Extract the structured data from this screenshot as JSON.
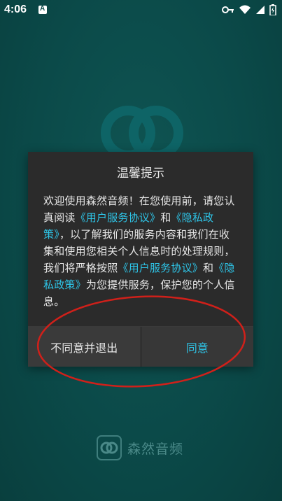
{
  "status_bar": {
    "time": "4:06",
    "notification_glyph": "A"
  },
  "dialog": {
    "title": "温馨提示",
    "body": {
      "t1": "欢迎使用森然音频！在您使用前，请您认真阅读",
      "l1": "《用户服务协议》",
      "t2": "和",
      "l2": "《隐私政策》",
      "t3": "，以了解我们的服务内容和我们在收集和使用您相关个人信息时的处理规则，我们将严格按照",
      "l3": "《用户服务协议》",
      "t4": "和",
      "l4": "《隐私政策》",
      "t5": "为您提供服务，保护您的个人信息。"
    },
    "disagree_label": "不同意并退出",
    "agree_label": "同意"
  },
  "footer": {
    "brand_name": "森然音频"
  },
  "colors": {
    "background": "#0b4a49",
    "link": "#2ec5e8",
    "dialog": "#2b2b2b",
    "annotation": "#d0201a"
  }
}
